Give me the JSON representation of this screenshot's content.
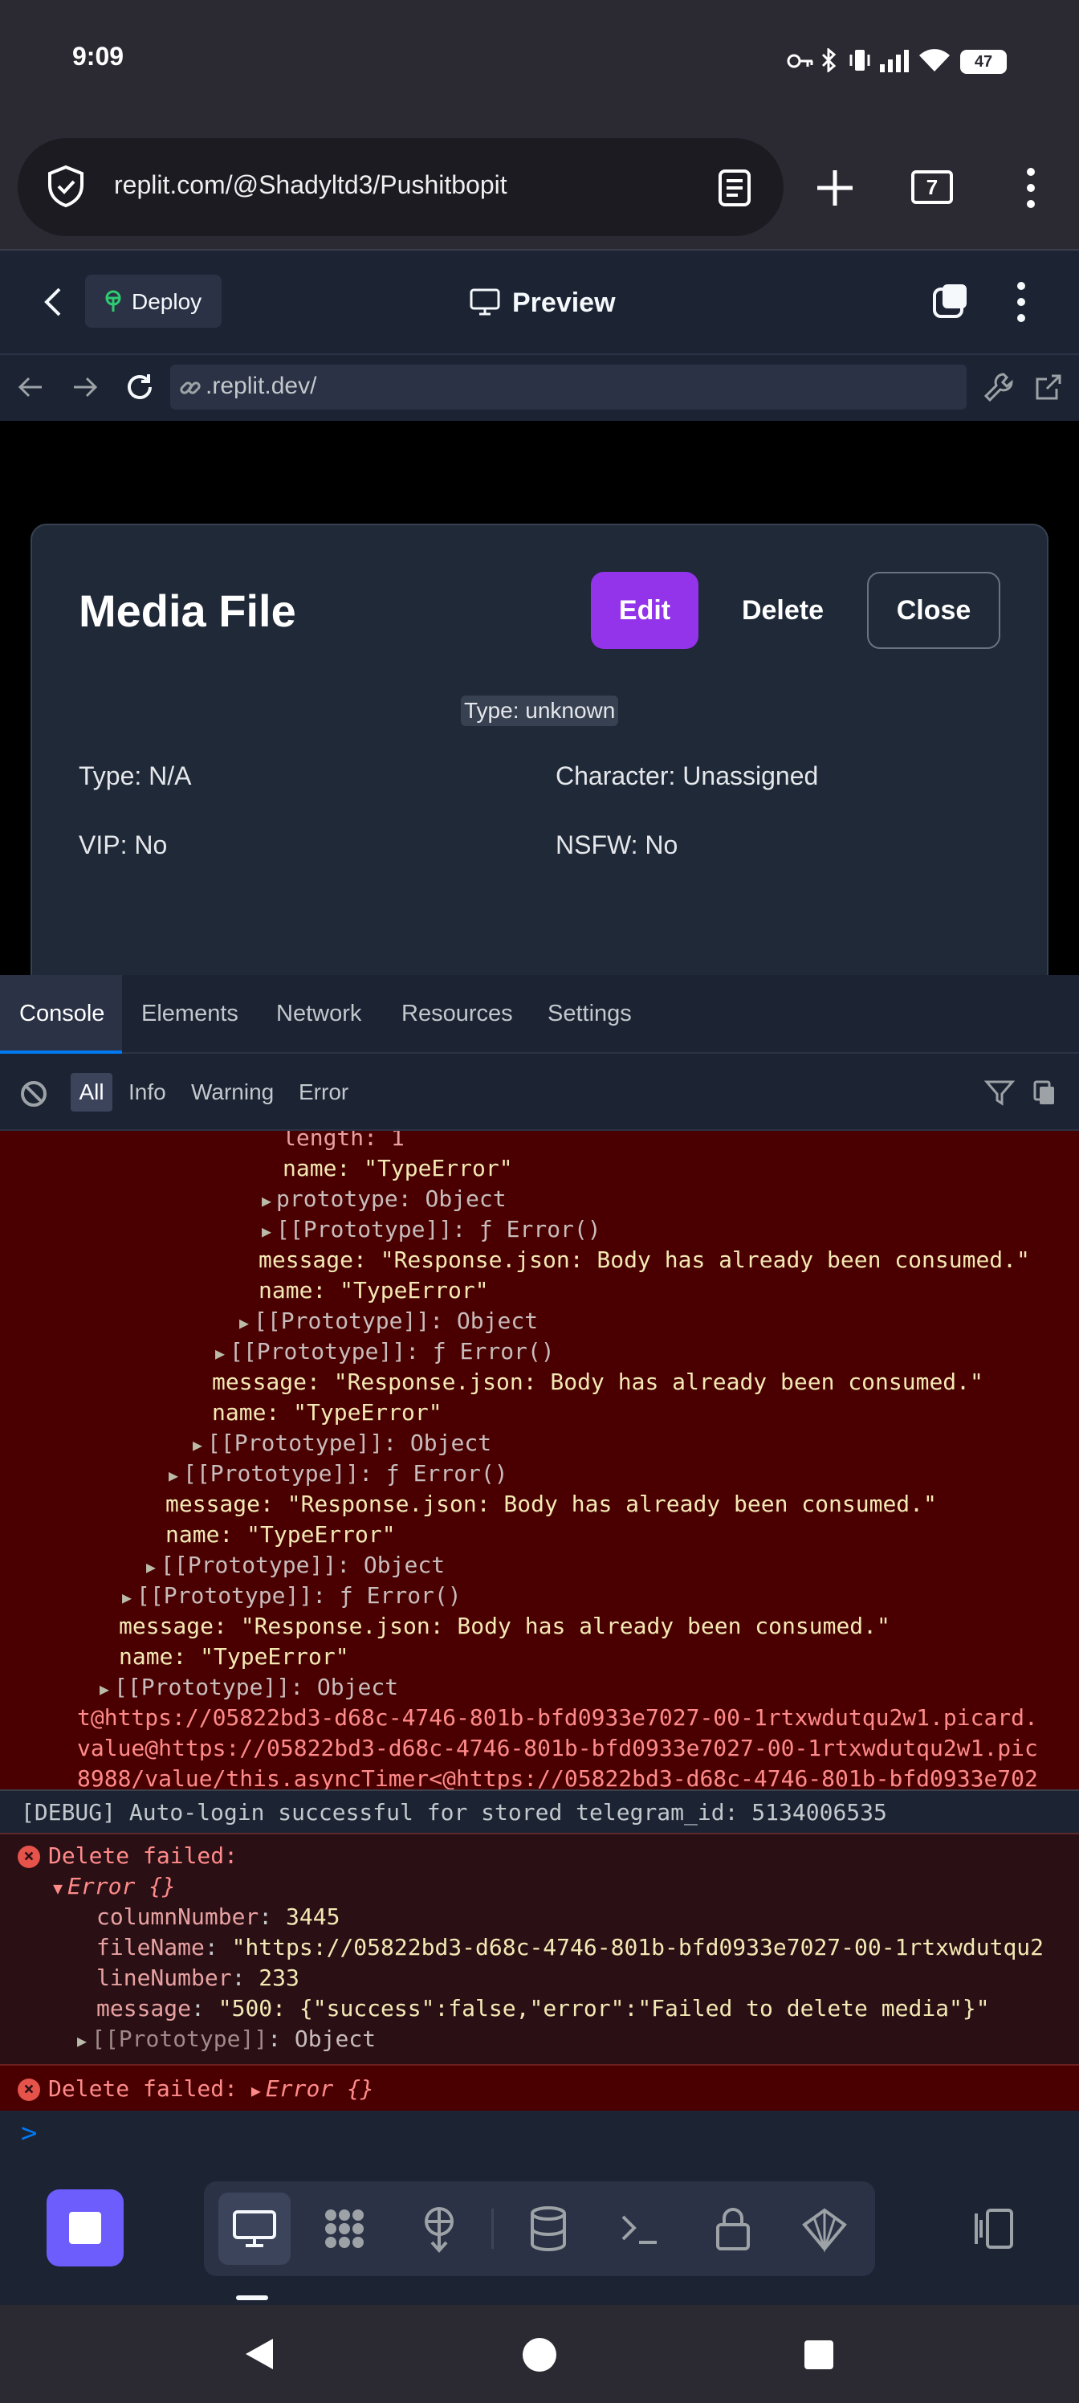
{
  "status_bar": {
    "time": "9:09",
    "battery": "47"
  },
  "browser": {
    "url": "replit.com/@Shadyltd3/Pushitbopit",
    "tab_count": "7"
  },
  "replit_header": {
    "deploy_label": "Deploy",
    "preview_label": "Preview"
  },
  "webview": {
    "url": ".replit.dev/"
  },
  "modal": {
    "title": "Media File",
    "edit_label": "Edit",
    "delete_label": "Delete",
    "close_label": "Close",
    "type_badge": "Type: unknown",
    "type": "Type: N/A",
    "character": "Character: Unassigned",
    "vip": "VIP: No",
    "nsfw": "NSFW: No"
  },
  "devtools": {
    "tabs": [
      "Console",
      "Elements",
      "Network",
      "Resources",
      "Settings"
    ],
    "filters": [
      "All",
      "Info",
      "Warning",
      "Error"
    ]
  },
  "console": {
    "trace_lines": [
      "length: 1",
      "name: \"TypeError\"",
      "prototype: Object",
      "[[Prototype]]: ƒ Error()",
      "message: \"Response.json: Body has already been consumed.\"",
      "name: \"TypeError\"",
      "[[Prototype]]: Object",
      "[[Prototype]]: ƒ Error()",
      "message: \"Response.json: Body has already been consumed.\"",
      "name: \"TypeError\"",
      "[[Prototype]]: Object",
      "[[Prototype]]: ƒ Error()",
      "message: \"Response.json: Body has already been consumed.\"",
      "name: \"TypeError\"",
      "[[Prototype]]: Object",
      "[[Prototype]]: ƒ Error()",
      "message: \"Response.json: Body has already been consumed.\"",
      "name: \"TypeError\"",
      "[[Prototype]]: Object"
    ],
    "stack_lines": [
      "t@https://05822bd3-d68c-4746-801b-bfd0933e7027-00-1rtxwdutqu2w1.picard.",
      "value@https://05822bd3-d68c-4746-801b-bfd0933e7027-00-1rtxwdutqu2w1.pic",
      "8988/value/this.asyncTimer<@https://05822bd3-d68c-4746-801b-bfd0933e702"
    ],
    "debug": "[DEBUG] Auto-login successful for stored telegram_id: 5134006535",
    "error2": {
      "header": "Delete failed:",
      "object": "Error {}",
      "column_key": "columnNumber",
      "column_val": "3445",
      "file_key": "fileName",
      "file_val": "\"https://05822bd3-d68c-4746-801b-bfd0933e7027-00-1rtxwdutqu2",
      "line_key": "lineNumber",
      "line_val": "233",
      "message_key": "message",
      "message_val": "\"500: {\"success\":false,\"error\":\"Failed to delete media\"}\"",
      "proto_key": "[[Prototype]]",
      "proto_val": "Object"
    },
    "error3": {
      "header": "Delete failed:",
      "object": "Error {}"
    },
    "prompt": ">"
  }
}
